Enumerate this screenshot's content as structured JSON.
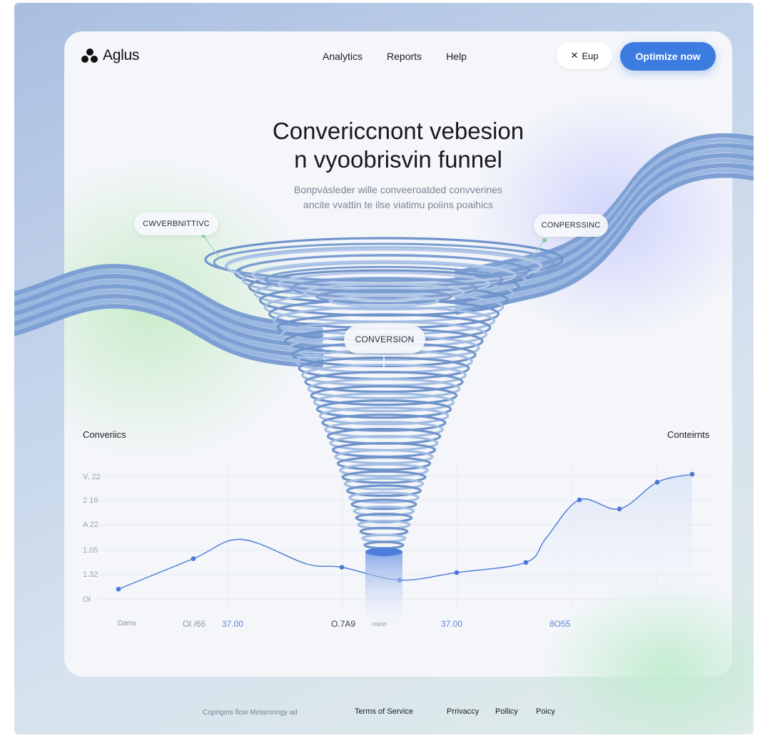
{
  "brand": {
    "name": "Aglus"
  },
  "nav": {
    "items": [
      "Analytics",
      "Reports",
      "Help"
    ]
  },
  "header": {
    "secondary_button": "Eup",
    "primary_button": "Optimize now"
  },
  "hero": {
    "title_line1": "Convericcnont vebesion",
    "title_line2": "n vyoobrisvin funnel",
    "subtitle_line1": "Bonpvásleder wille conveeroatded convverines",
    "subtitle_line2": "ancite vvattin te ilse viatimu poiins poaihics"
  },
  "funnel": {
    "chip_left": "CWVERBNITTIVC",
    "chip_right": "CONPERSSINC",
    "chip_center": "CONVERSION"
  },
  "chart": {
    "left_label": "Converiics",
    "right_label": "Conteirnts",
    "y_ticks": [
      "V, 22",
      "2 16",
      "A 22",
      "1.05",
      "1.32",
      "Ol"
    ],
    "x_ticks": [
      {
        "text": "Dams",
        "blue": false
      },
      {
        "text": "Ol /66",
        "blue": false
      },
      {
        "text": "37.00",
        "blue": true
      },
      {
        "text": "O.7A9",
        "blue": false
      },
      {
        "text": "nunn",
        "blue": false
      },
      {
        "text": "37.00",
        "blue": true
      },
      {
        "text": "8O55",
        "blue": true
      }
    ]
  },
  "chart_data": {
    "type": "line",
    "series": [
      {
        "values": [
          0.05,
          0.62,
          0.98,
          0.52,
          0.46,
          0.22,
          0.36,
          0.55,
          1.0,
          1.72,
          1.55,
          2.05,
          2.2
        ]
      }
    ],
    "colors": {
      "line": "#4a78d6",
      "fill": "#dde6f7"
    }
  },
  "footer": {
    "copyright": "Coprigms flow Metaronngy ad",
    "links": [
      "Terms of Service",
      "Prrivaccy",
      "Pollicy",
      "Poicy"
    ]
  },
  "colors": {
    "accent": "#3c7bdf",
    "funnel": "#7fa1d3"
  }
}
